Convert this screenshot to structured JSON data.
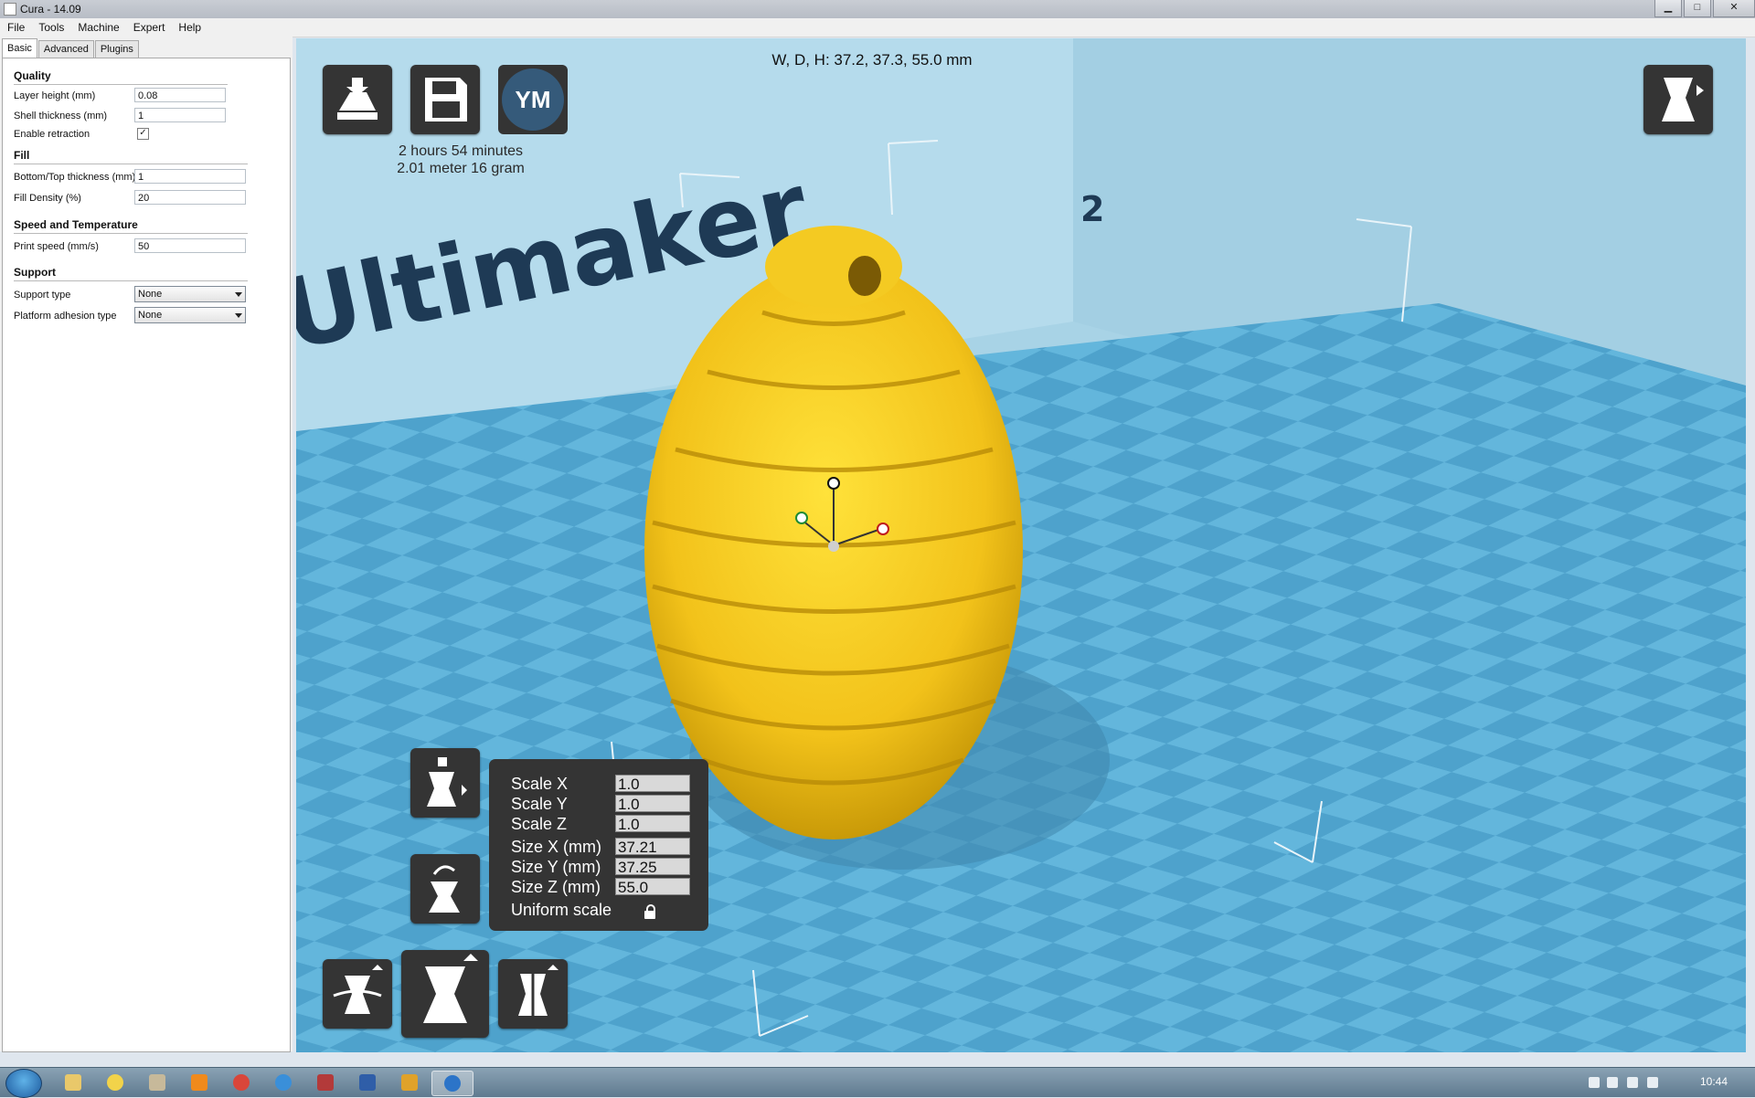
{
  "window": {
    "title": "Cura - 14.09"
  },
  "menu": [
    "File",
    "Tools",
    "Machine",
    "Expert",
    "Help"
  ],
  "tabs": [
    "Basic",
    "Advanced",
    "Plugins"
  ],
  "settings": {
    "quality": {
      "heading": "Quality",
      "layer_height_label": "Layer height (mm)",
      "layer_height": "0.08",
      "shell_label": "Shell thickness (mm)",
      "shell": "1",
      "retraction_label": "Enable retraction",
      "retraction": "✓"
    },
    "fill": {
      "heading": "Fill",
      "bottom_top_label": "Bottom/Top thickness (mm)",
      "bottom_top": "1",
      "density_label": "Fill Density (%)",
      "density": "20"
    },
    "speed": {
      "heading": "Speed and Temperature",
      "print_speed_label": "Print speed (mm/s)",
      "print_speed": "50"
    },
    "support": {
      "heading": "Support",
      "support_type_label": "Support type",
      "support_type": "None",
      "adhesion_label": "Platform adhesion type",
      "adhesion": "None"
    }
  },
  "viewport": {
    "dimensions": "W, D, H: 37.2, 37.3, 55.0 mm",
    "print_time": "2 hours 54 minutes",
    "print_material": "2.01 meter 16 gram",
    "ym_label": "YM",
    "brand": "Ultimaker",
    "brand_sup": "2",
    "model_color": "#f3c21a",
    "bed_color": "#5aaed6"
  },
  "scale_panel": {
    "scale_x_label": "Scale X",
    "scale_x": "1.0",
    "scale_y_label": "Scale Y",
    "scale_y": "1.0",
    "scale_z_label": "Scale Z",
    "scale_z": "1.0",
    "size_x_label": "Size X (mm)",
    "size_x": "37.21",
    "size_y_label": "Size Y (mm)",
    "size_y": "37.25",
    "size_z_label": "Size Z (mm)",
    "size_z": "55.0",
    "uniform_label": "Uniform scale"
  },
  "taskbar": {
    "clock": "10:44"
  }
}
